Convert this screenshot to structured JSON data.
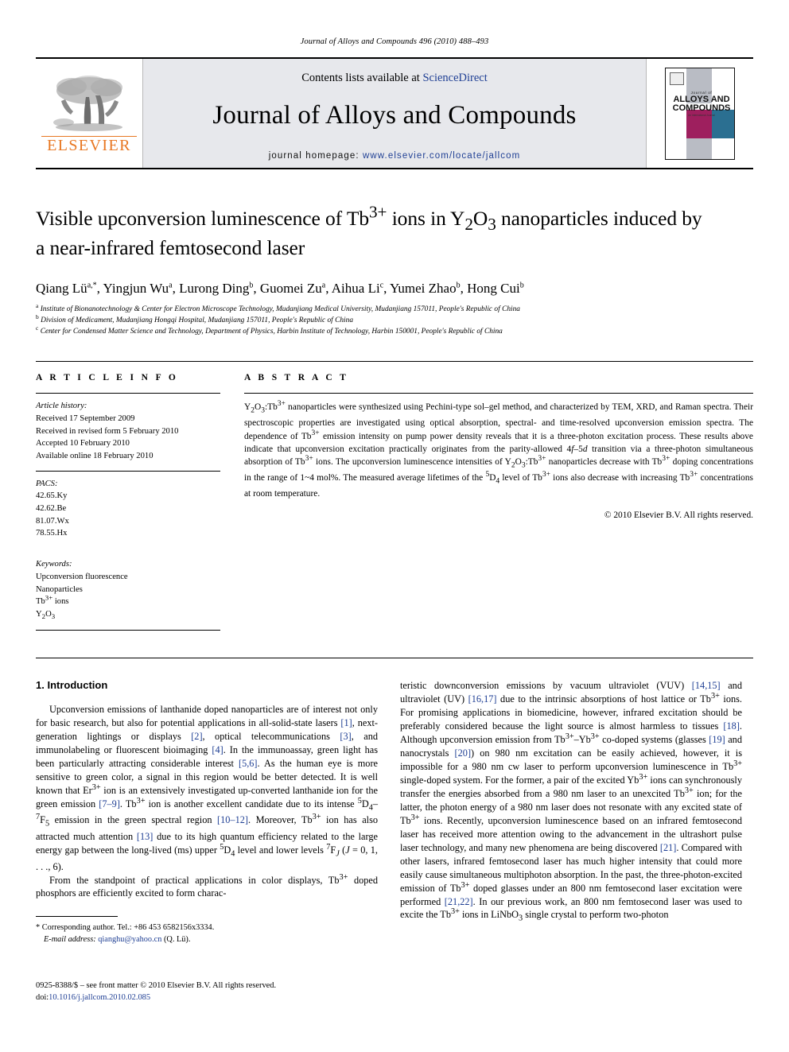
{
  "running_head": "Journal of Alloys and Compounds 496 (2010) 488–493",
  "masthead": {
    "contents_prefix": "Contents lists available at ",
    "sciencedirect": "ScienceDirect",
    "journal_title": "Journal of Alloys and Compounds",
    "homepage_prefix": "journal homepage: ",
    "homepage_url": "www.elsevier.com/locate/jallcom",
    "publisher_logo_text": "ELSEVIER",
    "cover": {
      "line1": "Journal of",
      "line2": "ALLOYS AND COMPOUNDS",
      "line3": "An International Journal"
    },
    "link_color": "#1f3f94",
    "elsevier_orange": "#E87722"
  },
  "article": {
    "title_line1_a": "Visible upconversion luminescence of Tb",
    "title_sup1": "3+",
    "title_line1_b": " ions in Y",
    "title_sub1": "2",
    "title_line1_c": "O",
    "title_sub2": "3",
    "title_line1_d": " nanoparticles induced by",
    "title_line2": "a near-infrared femtosecond laser",
    "authors_text": "Qiang Lü a,*, Yingjun Wu a, Lurong Ding b, Guomei Zu a, Aihua Li c, Yumei Zhao b, Hong Cui b",
    "authors": [
      {
        "name": "Qiang Lü",
        "marks": "a,*"
      },
      {
        "name": "Yingjun Wu",
        "marks": "a"
      },
      {
        "name": "Lurong Ding",
        "marks": "b"
      },
      {
        "name": "Guomei Zu",
        "marks": "a"
      },
      {
        "name": "Aihua Li",
        "marks": "c"
      },
      {
        "name": "Yumei Zhao",
        "marks": "b"
      },
      {
        "name": "Hong Cui",
        "marks": "b"
      }
    ],
    "affiliations": [
      {
        "mark": "a",
        "text": "Institute of Bionanotechnology & Center for Electron Microscope Technology, Mudanjiang Medical University, Mudanjiang 157011, People's Republic of China"
      },
      {
        "mark": "b",
        "text": "Division of Medicament, Mudanjiang Hongqi Hospital, Mudanjiang 157011, People's Republic of China"
      },
      {
        "mark": "c",
        "text": "Center for Condensed Matter Science and Technology, Department of Physics, Harbin Institute of Technology, Harbin 150001, People's Republic of China"
      }
    ]
  },
  "article_info": {
    "heading": "A R T I C L E   I N F O",
    "history_label": "Article history:",
    "history": [
      "Received 17 September 2009",
      "Received in revised form 5 February 2010",
      "Accepted 10 February 2010",
      "Available online 18 February 2010"
    ],
    "pacs_label": "PACS:",
    "pacs": [
      "42.65.Ky",
      "42.62.Be",
      "81.07.Wx",
      "78.55.Hx"
    ],
    "keywords_label": "Keywords:",
    "keywords_plain": [
      "Upconversion fluorescence",
      "Nanoparticles",
      "Tb3+ ions",
      "Y2O3"
    ]
  },
  "abstract": {
    "heading": "A B S T R A C T",
    "paragraph": "Y2O3:Tb3+ nanoparticles were synthesized using Pechini-type sol–gel method, and characterized by TEM, XRD, and Raman spectra. Their spectroscopic properties are investigated using optical absorption, spectral- and time-resolved upconversion emission spectra. The dependence of Tb3+ emission intensity on pump power density reveals that it is a three-photon excitation process. These results above indicate that upconversion excitation practically originates from the parity-allowed 4f–5d transition via a three-photon simultaneous absorption of Tb3+ ions. The upconversion luminescence intensities of Y2O3:Tb3+ nanoparticles decrease with Tb3+ doping concentrations in the range of 1~4 mol%. The measured average lifetimes of the 5D4 level of Tb3+ ions also decrease with increasing Tb3+ concentrations at room temperature.",
    "copyright": "© 2010 Elsevier B.V. All rights reserved."
  },
  "body": {
    "section_number_title": "1. Introduction",
    "left_paragraph_1": "Upconversion emissions of lanthanide doped nanoparticles are of interest not only for basic research, but also for potential applications in all-solid-state lasers [1], next-generation lightings or displays [2], optical telecommunications [3], and immunolabeling or fluorescent bioimaging [4]. In the immunoassay, green light has been particularly attracting considerable interest [5,6]. As the human eye is more sensitive to green color, a signal in this region would be better detected. It is well known that Er3+ ion is an extensively investigated up-converted lanthanide ion for the green emission [7–9]. Tb3+ ion is another excellent candidate due to its intense 5D4–7F5 emission in the green spectral region [10–12]. Moreover, Tb3+ ion has also attracted much attention [13] due to its high quantum efficiency related to the large energy gap between the long-lived (ms) upper 5D4 level and lower levels 7FJ (J = 0, 1, . . ., 6).",
    "left_paragraph_2": "From the standpoint of practical applications in color displays, Tb3+ doped phosphors are efficiently excited to form charac-",
    "right_paragraph_1": "teristic downconversion emissions by vacuum ultraviolet (VUV) [14,15] and ultraviolet (UV) [16,17] due to the intrinsic absorptions of host lattice or Tb3+ ions. For promising applications in biomedicine, however, infrared excitation should be preferably considered because the light source is almost harmless to tissues [18]. Although upconversion emission from Tb3+–Yb3+ co-doped systems (glasses [19] and nanocrystals [20]) on 980 nm excitation can be easily achieved, however, it is impossible for a 980 nm cw laser to perform upconversion luminescence in Tb3+ single-doped system. For the former, a pair of the excited Yb3+ ions can synchronously transfer the energies absorbed from a 980 nm laser to an unexcited Tb3+ ion; for the latter, the photon energy of a 980 nm laser does not resonate with any excited state of Tb3+ ions. Recently, upconversion luminescence based on an infrared femtosecond laser has received more attention owing to the advancement in the ultrashort pulse laser technology, and many new phenomena are being discovered [21]. Compared with other lasers, infrared femtosecond laser has much higher intensity that could more easily cause simultaneous multiphoton absorption. In the past, the three-photon-excited emission of Tb3+ doped glasses under an 800 nm femtosecond laser excitation were performed [21,22]. In our previous work, an 800 nm femtosecond laser was used to excite the Tb3+ ions in LiNbO3 single crystal to perform two-photon"
  },
  "footnote": {
    "corresponding": "* Corresponding author. Tel.: +86 453 6582156x3334.",
    "email_label": "E-mail address:",
    "email": "qianghu@yahoo.cn",
    "email_suffix": " (Q. Lü)."
  },
  "footer": {
    "issn_line": "0925-8388/$ – see front matter © 2010 Elsevier B.V. All rights reserved.",
    "doi_label": "doi:",
    "doi": "10.1016/j.jallcom.2010.02.085"
  }
}
